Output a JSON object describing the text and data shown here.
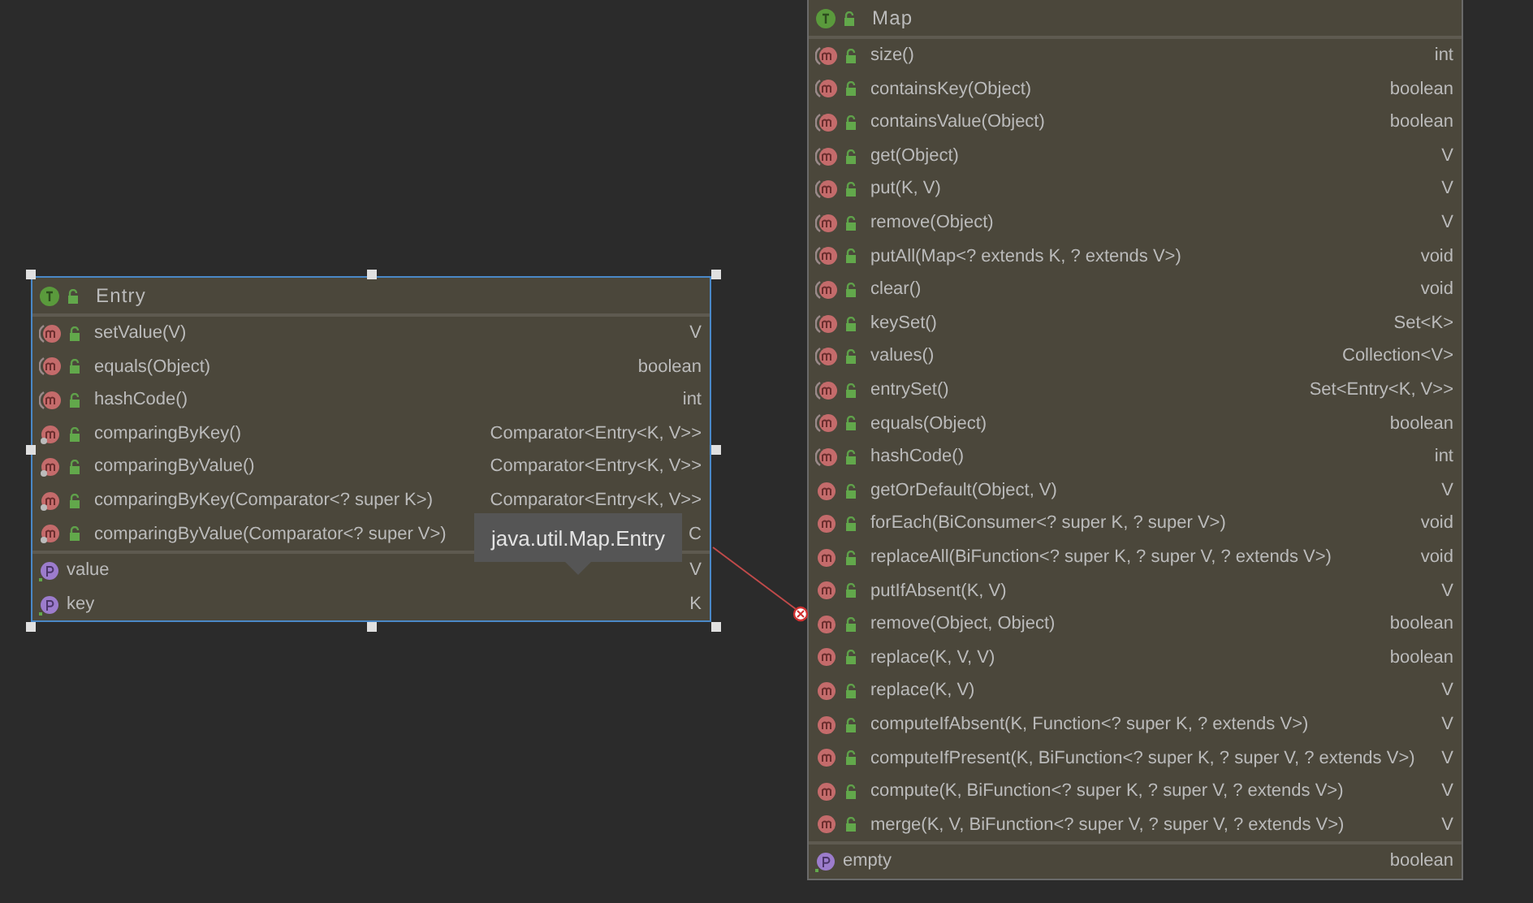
{
  "diagram": {
    "classes": [
      {
        "name": "Entry",
        "selected": true,
        "methods": [
          {
            "signature": "setValue(V)",
            "type": "V",
            "kind": "abstract"
          },
          {
            "signature": "equals(Object)",
            "type": "boolean",
            "kind": "abstract"
          },
          {
            "signature": "hashCode()",
            "type": "int",
            "kind": "abstract"
          },
          {
            "signature": "comparingByKey()",
            "type": "Comparator<Entry<K, V>>",
            "kind": "static"
          },
          {
            "signature": "comparingByValue()",
            "type": "Comparator<Entry<K, V>>",
            "kind": "static"
          },
          {
            "signature": "comparingByKey(Comparator<? super K>)",
            "type": "Comparator<Entry<K, V>>",
            "kind": "static"
          },
          {
            "signature": "comparingByValue(Comparator<? super V>)",
            "type": "C",
            "kind": "static"
          }
        ],
        "fields": [
          {
            "name": "value",
            "type": "V"
          },
          {
            "name": "key",
            "type": "K"
          }
        ]
      },
      {
        "name": "Map",
        "selected": false,
        "methods": [
          {
            "signature": "size()",
            "type": "int",
            "kind": "abstract"
          },
          {
            "signature": "containsKey(Object)",
            "type": "boolean",
            "kind": "abstract"
          },
          {
            "signature": "containsValue(Object)",
            "type": "boolean",
            "kind": "abstract"
          },
          {
            "signature": "get(Object)",
            "type": "V",
            "kind": "abstract"
          },
          {
            "signature": "put(K, V)",
            "type": "V",
            "kind": "abstract"
          },
          {
            "signature": "remove(Object)",
            "type": "V",
            "kind": "abstract"
          },
          {
            "signature": "putAll(Map<? extends K, ? extends V>)",
            "type": "void",
            "kind": "abstract"
          },
          {
            "signature": "clear()",
            "type": "void",
            "kind": "abstract"
          },
          {
            "signature": "keySet()",
            "type": "Set<K>",
            "kind": "abstract"
          },
          {
            "signature": "values()",
            "type": "Collection<V>",
            "kind": "abstract"
          },
          {
            "signature": "entrySet()",
            "type": "Set<Entry<K, V>>",
            "kind": "abstract"
          },
          {
            "signature": "equals(Object)",
            "type": "boolean",
            "kind": "abstract"
          },
          {
            "signature": "hashCode()",
            "type": "int",
            "kind": "abstract"
          },
          {
            "signature": "getOrDefault(Object, V)",
            "type": "V",
            "kind": "default"
          },
          {
            "signature": "forEach(BiConsumer<? super K, ? super V>)",
            "type": "void",
            "kind": "default"
          },
          {
            "signature": "replaceAll(BiFunction<? super K, ? super V, ? extends V>)",
            "type": "void",
            "kind": "default"
          },
          {
            "signature": "putIfAbsent(K, V)",
            "type": "V",
            "kind": "default"
          },
          {
            "signature": "remove(Object, Object)",
            "type": "boolean",
            "kind": "default"
          },
          {
            "signature": "replace(K, V, V)",
            "type": "boolean",
            "kind": "default"
          },
          {
            "signature": "replace(K, V)",
            "type": "V",
            "kind": "default"
          },
          {
            "signature": "computeIfAbsent(K, Function<? super K, ? extends V>)",
            "type": "V",
            "kind": "default"
          },
          {
            "signature": "computeIfPresent(K, BiFunction<? super K, ? super V, ? extends V>)",
            "type": "V",
            "kind": "default"
          },
          {
            "signature": "compute(K, BiFunction<? super K, ? super V, ? extends V>)",
            "type": "V",
            "kind": "default"
          },
          {
            "signature": "merge(K, V, BiFunction<? super V, ? super V, ? extends V>)",
            "type": "V",
            "kind": "default"
          }
        ],
        "fields": [
          {
            "name": "empty",
            "type": "boolean"
          }
        ]
      }
    ],
    "tooltip": {
      "text": "java.util.Map.Entry"
    }
  }
}
